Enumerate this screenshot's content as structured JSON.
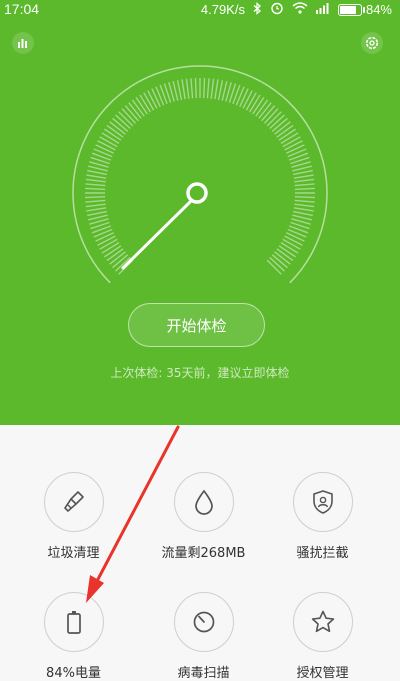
{
  "status_bar": {
    "time": "17:04",
    "network_speed": "4.79K/s",
    "battery": "84%",
    "battery_level": 0.84,
    "icons": [
      "bluetooth-icon",
      "alarm-icon",
      "wifi-icon",
      "signal-icon",
      "battery-icon"
    ]
  },
  "header": {
    "stats_icon": "bar-chart-icon",
    "settings_icon": "gear-icon"
  },
  "main": {
    "start_button_label": "开始体检",
    "last_check_text": "上次体检: 35天前，建议立即体检"
  },
  "tools": [
    {
      "label": "垃圾清理",
      "icon": "broom-icon"
    },
    {
      "label": "流量剩268MB",
      "icon": "droplet-icon"
    },
    {
      "label": "骚扰拦截",
      "icon": "shield-icon"
    },
    {
      "label": "84%电量",
      "icon": "battery-icon"
    },
    {
      "label": "病毒扫描",
      "icon": "scan-dial-icon"
    },
    {
      "label": "授权管理",
      "icon": "star-icon"
    }
  ],
  "colors": {
    "primary_green": "#5cb92c",
    "annotation_arrow": "#e8342a",
    "background": "#f7f7f7"
  }
}
